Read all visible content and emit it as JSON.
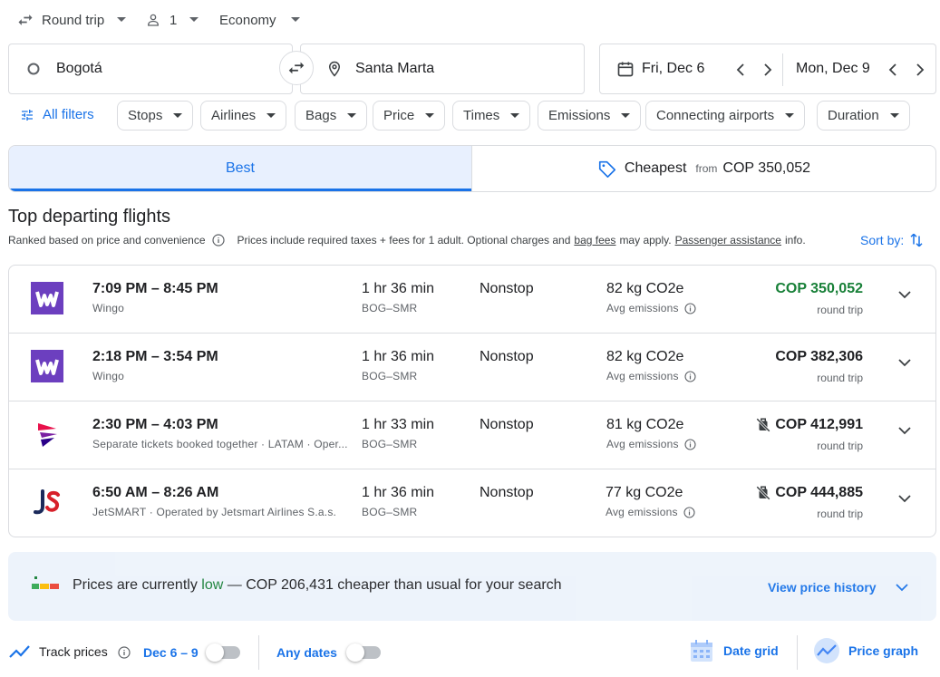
{
  "top": {
    "trip_type": "Round trip",
    "passengers": "1",
    "cabin": "Economy"
  },
  "search": {
    "origin": "Bogotá",
    "destination": "Santa Marta",
    "depart_date": "Fri, Dec 6",
    "return_date": "Mon, Dec 9"
  },
  "filters": {
    "all_filters": "All filters",
    "chips": [
      "Stops",
      "Airlines",
      "Bags",
      "Price",
      "Times",
      "Emissions",
      "Connecting airports",
      "Duration"
    ]
  },
  "tabs": {
    "best": "Best",
    "cheapest": "Cheapest",
    "from": "from",
    "cheapest_price": "COP 350,052"
  },
  "section": {
    "title": "Top departing flights",
    "ranked": "Ranked based on price and convenience",
    "prices_note": "Prices include required taxes + fees for 1 adult. Optional charges and",
    "bag_fees": "bag fees",
    "may_apply": "may apply.",
    "passenger_assistance": "Passenger assistance",
    "info": "info.",
    "sort_by": "Sort by:"
  },
  "flights": [
    {
      "times": "7:09 PM – 8:45 PM",
      "airline": "Wingo",
      "duration": "1 hr 36 min",
      "route": "BOG–SMR",
      "stops": "Nonstop",
      "emissions": "82 kg CO2e",
      "emissions_label": "Avg emissions",
      "price": "COP 350,052",
      "price_note": "round trip",
      "logo": "wingo-logo"
    },
    {
      "times": "2:18 PM – 3:54 PM",
      "airline": "Wingo",
      "duration": "1 hr 36 min",
      "route": "BOG–SMR",
      "stops": "Nonstop",
      "emissions": "82 kg CO2e",
      "emissions_label": "Avg emissions",
      "price": "COP 382,306",
      "price_note": "round trip",
      "logo": "wingo-logo"
    },
    {
      "times": "2:30 PM – 4:03 PM",
      "airline": "Separate tickets booked together · LATAM · Oper...",
      "duration": "1 hr 33 min",
      "route": "BOG–SMR",
      "stops": "Nonstop",
      "emissions": "81 kg CO2e",
      "emissions_label": "Avg emissions",
      "price": "COP 412,991",
      "price_note": "round trip",
      "logo": "latam-logo"
    },
    {
      "times": "6:50 AM – 8:26 AM",
      "airline": "JetSMART · Operated by Jetsmart Airlines S.a.s.",
      "duration": "1 hr 36 min",
      "route": "BOG–SMR",
      "stops": "Nonstop",
      "emissions": "77 kg CO2e",
      "emissions_label": "Avg emissions",
      "price": "COP 444,885",
      "price_note": "round trip",
      "logo": "jetsmart-logo"
    }
  ],
  "insight": {
    "prefix": "Prices are currently",
    "level": "low",
    "suffix": "— COP 206,431 cheaper than usual for your search",
    "view_history": "View price history"
  },
  "bottom": {
    "track_prices": "Track prices",
    "date_range": "Dec 6 – 9",
    "any_dates": "Any dates",
    "date_grid": "Date grid",
    "price_graph": "Price graph"
  },
  "colors": {
    "accent": "#1a73e8",
    "price_green": "#188038",
    "wingo_purple": "#6c3fbf",
    "latam_red": "#e8114b",
    "latam_blue": "#2a0088",
    "jetsmart_navy": "#1b2a5b",
    "jetsmart_red": "#d7202a"
  }
}
